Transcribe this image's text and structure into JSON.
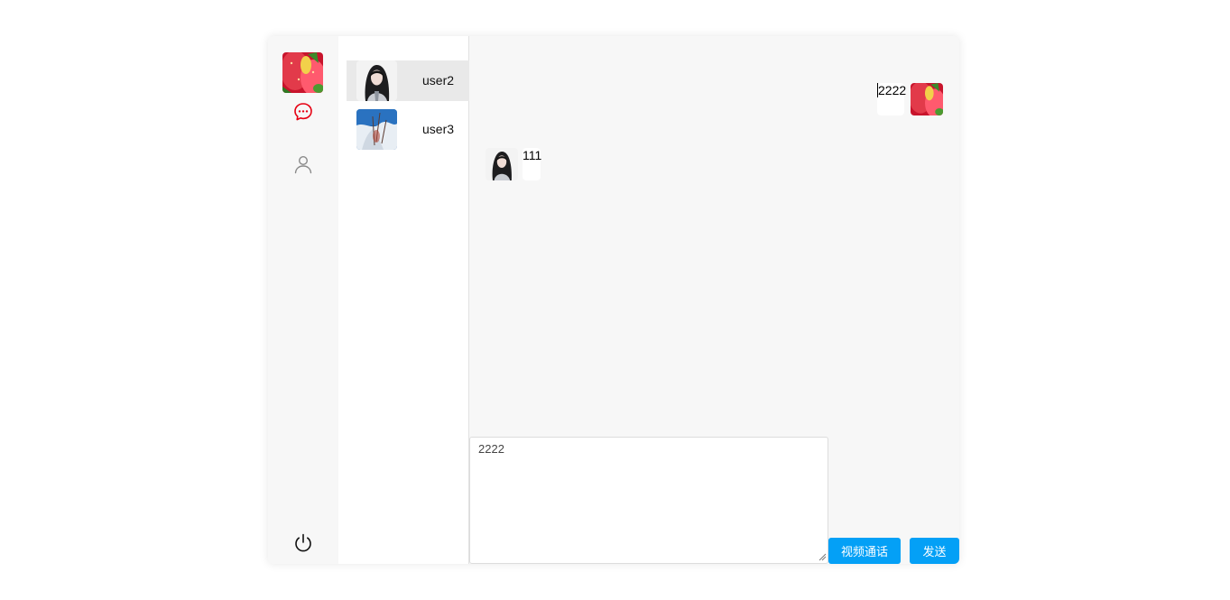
{
  "sidebar": {
    "self_avatar": "strawberry-avatar",
    "chat_icon": "chat-bubble-icon",
    "contacts_icon": "user-icon",
    "logout_icon": "power-icon",
    "active_color": "#e60012"
  },
  "contacts": [
    {
      "name": "user2",
      "avatar": "dark-hair-girl-avatar",
      "active": true
    },
    {
      "name": "user3",
      "avatar": "blue-snow-avatar",
      "active": false
    }
  ],
  "messages": [
    {
      "from": "self",
      "text": "2222"
    },
    {
      "from": "user2",
      "text": "111"
    }
  ],
  "composer": {
    "value": "2222"
  },
  "buttons": {
    "video_call": "视频通话",
    "send": "发送"
  },
  "colors": {
    "accent": "#04a0f6",
    "panel": "#f7f7f7",
    "active_item": "#e9e9e9"
  }
}
